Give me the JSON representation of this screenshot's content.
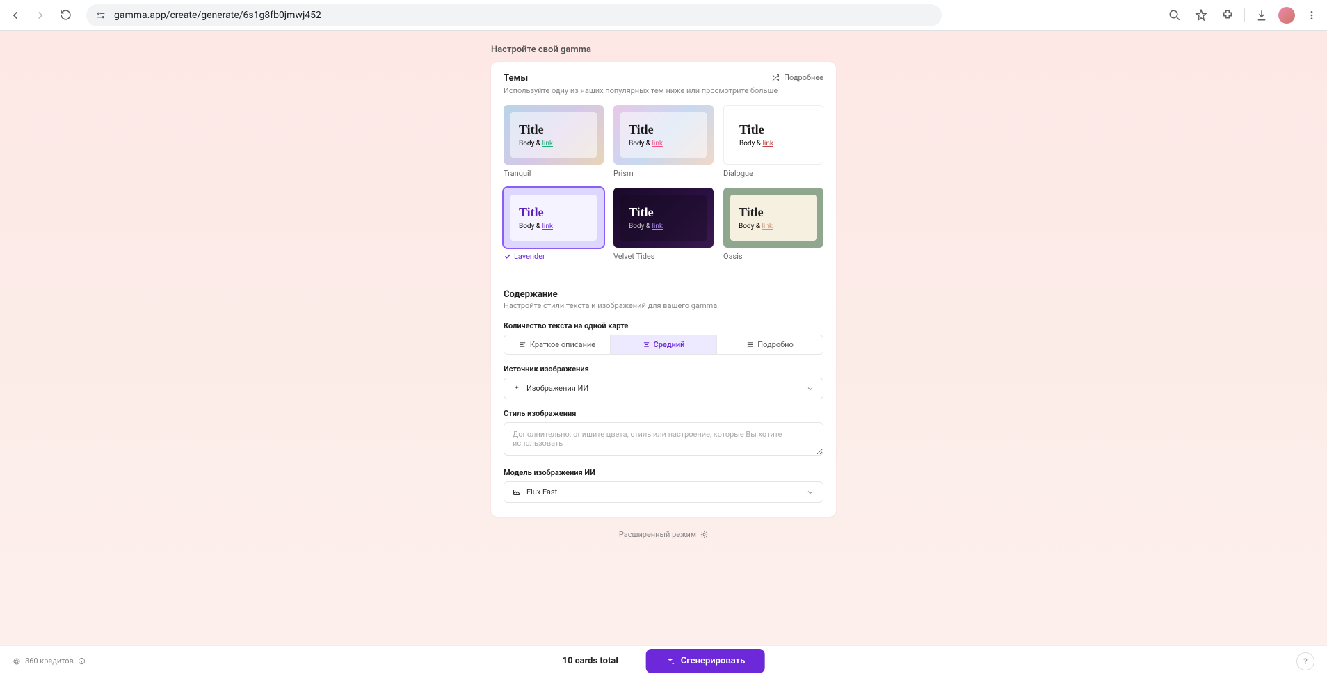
{
  "browser": {
    "url": "gamma.app/create/generate/6s1g8fb0jmwj452"
  },
  "outer_title": "Настройте свой gamma",
  "themes": {
    "title": "Темы",
    "subtitle": "Используйте одну из наших популярных тем ниже или просмотрите больше",
    "more": "Подробнее",
    "preview_title": "Title",
    "preview_body": "Body & ",
    "preview_link": "link",
    "items": [
      {
        "name": "Tranquil",
        "selected": false
      },
      {
        "name": "Prism",
        "selected": false
      },
      {
        "name": "Dialogue",
        "selected": false
      },
      {
        "name": "Lavender",
        "selected": true
      },
      {
        "name": "Velvet Tides",
        "selected": false
      },
      {
        "name": "Oasis",
        "selected": false
      }
    ]
  },
  "content": {
    "title": "Содержание",
    "subtitle": "Настройте стили текста и изображений для вашего gamma",
    "text_amount": {
      "label": "Количество текста на одной карте",
      "options": [
        "Краткое описание",
        "Средний",
        "Подробно"
      ],
      "selected": "Средний"
    },
    "image_source": {
      "label": "Источник изображения",
      "value": "Изображения ИИ"
    },
    "image_style": {
      "label": "Стиль изображения",
      "placeholder": "Дополнительно: опишите цвета, стиль или настроение, которые Вы хотите использовать"
    },
    "image_model": {
      "label": "Модель изображения ИИ",
      "value": "Flux Fast"
    }
  },
  "advanced": "Расширенный режим",
  "footer": {
    "credits": "360 кредитов",
    "cards_total": "10 cards total",
    "generate": "Сгенерировать"
  }
}
